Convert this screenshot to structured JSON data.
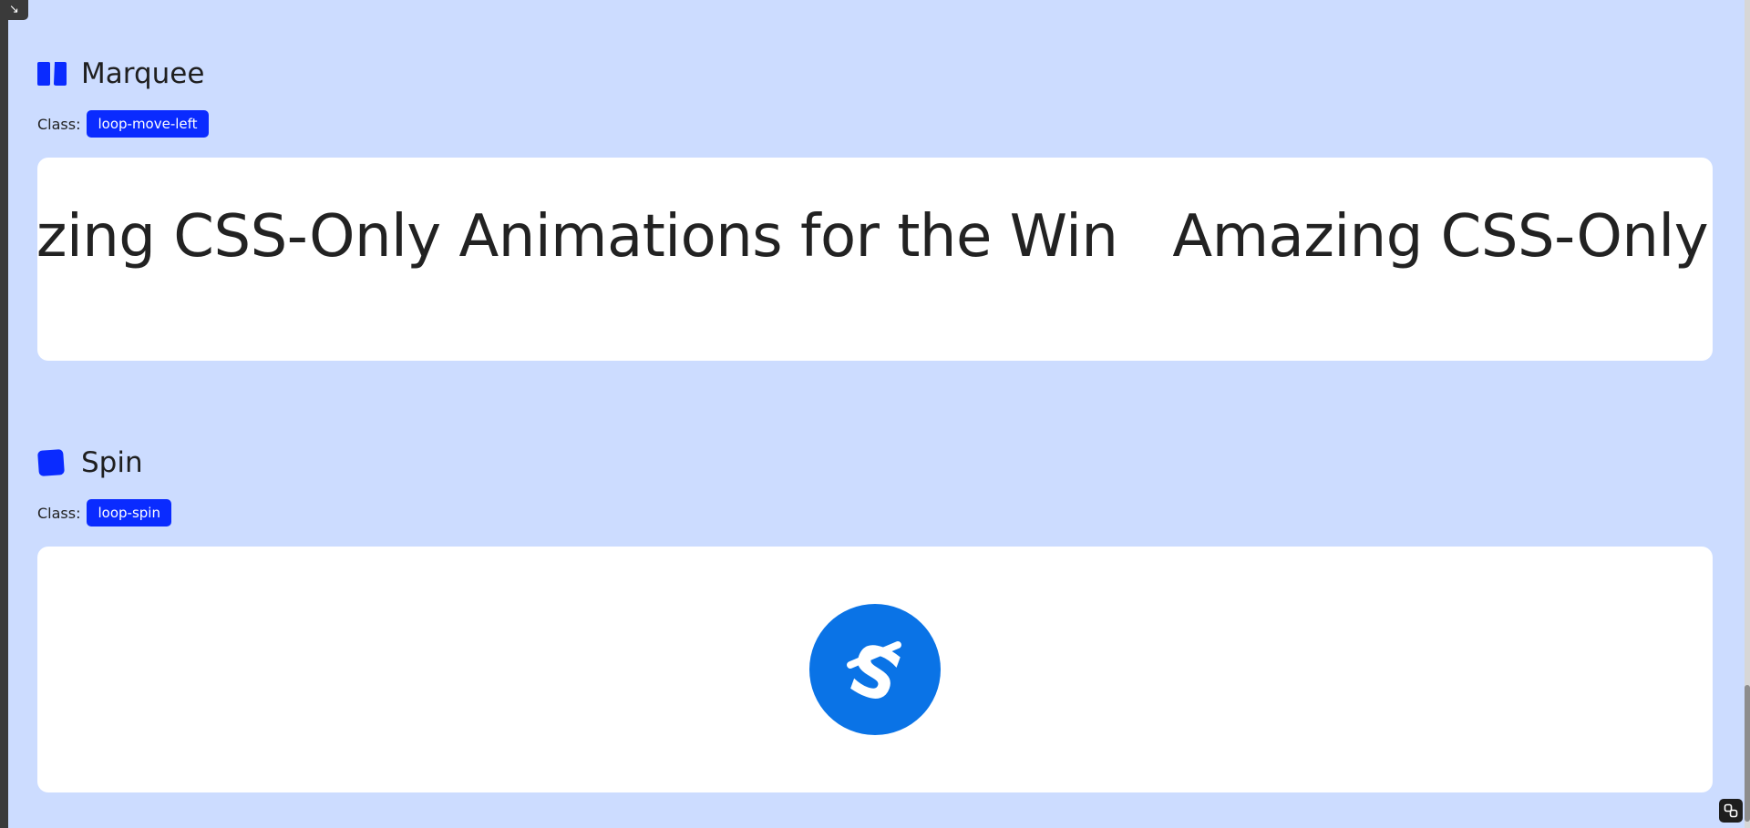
{
  "corner_button": {
    "glyph": "↘"
  },
  "marquee_section": {
    "title": "Marquee",
    "class_label": "Class:",
    "class_name": "loop-move-left",
    "marquee_text": "Amazing CSS-Only Animations for the Win"
  },
  "spin_section": {
    "title": "Spin",
    "class_label": "Class:",
    "class_name": "loop-spin",
    "logo_glyph": "S"
  },
  "colors": {
    "background": "#ccdcff",
    "badge": "#0a2bff",
    "logo": "#0a73e6",
    "panel": "#ffffff"
  },
  "icons": {
    "marquee": "pause-bars-icon",
    "spin": "rounded-square-icon",
    "fab": "link-icon"
  }
}
